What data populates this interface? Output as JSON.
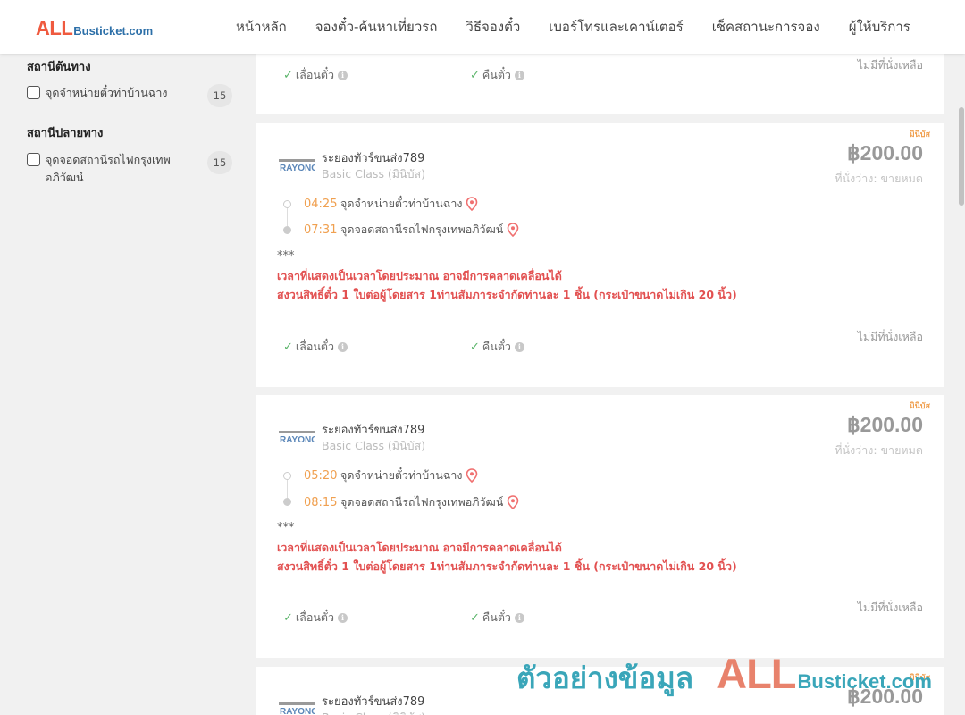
{
  "header": {
    "logo_all": "ALL",
    "logo_rest": "Busticket.com",
    "nav": [
      "หน้าหลัก",
      "จองตั๋ว-ค้นหาเที่ยวรถ",
      "วิธีจองตั๋ว",
      "เบอร์โทรและเคาน์เตอร์",
      "เช็คสถานะการจอง",
      "ผู้ให้บริการ"
    ]
  },
  "sidebar": {
    "origin_title": "สถานีต้นทาง",
    "origin_items": [
      {
        "label": "จุดจำหน่ายตั๋วท่าบ้านฉาง",
        "count": "15"
      }
    ],
    "dest_title": "สถานีปลายทาง",
    "dest_items": [
      {
        "label": "จุดจอดสถานีรถไฟกรุงเทพอภิวัฒน์",
        "count": "15"
      }
    ]
  },
  "top_card": {
    "reschedule": "เลื่อนตั๋ว",
    "refund": "คืนตั๋ว",
    "no_seats": "ไม่มีที่นั่งเหลือ"
  },
  "trips": [
    {
      "tag": "มินิบัส",
      "operator": "ระยองทัวร์ขนส่ง789",
      "bus_class": "Basic Class (มินิบัส)",
      "price": "฿200.00",
      "seats": "ที่นั่งว่าง: ขายหมด",
      "depart_time": "04:25",
      "depart_station": "จุดจำหน่ายตั๋วท่าบ้านฉาง",
      "arrive_time": "07:31",
      "arrive_station": "จุดจอดสถานีรถไฟกรุงเทพอภิวัฒน์",
      "stars": "***",
      "warn1": "เวลาที่แสดงเป็นเวลาโดยประมาณ อาจมีการคลาดเคลื่อนได้",
      "warn2": "สงวนสิทธิ์ตั๋ว 1 ใบต่อผู้โดยสาร 1ท่านสัมภาระจำกัดท่านละ 1 ชิ้น (กระเป๋าขนาดไม่เกิน 20 นิ้ว)",
      "reschedule": "เลื่อนตั๋ว",
      "refund": "คืนตั๋ว",
      "no_seats": "ไม่มีที่นั่งเหลือ"
    },
    {
      "tag": "มินิบัส",
      "operator": "ระยองทัวร์ขนส่ง789",
      "bus_class": "Basic Class (มินิบัส)",
      "price": "฿200.00",
      "seats": "ที่นั่งว่าง: ขายหมด",
      "depart_time": "05:20",
      "depart_station": "จุดจำหน่ายตั๋วท่าบ้านฉาง",
      "arrive_time": "08:15",
      "arrive_station": "จุดจอดสถานีรถไฟกรุงเทพอภิวัฒน์",
      "stars": "***",
      "warn1": "เวลาที่แสดงเป็นเวลาโดยประมาณ อาจมีการคลาดเคลื่อนได้",
      "warn2": "สงวนสิทธิ์ตั๋ว 1 ใบต่อผู้โดยสาร 1ท่านสัมภาระจำกัดท่านละ 1 ชิ้น (กระเป๋าขนาดไม่เกิน 20 นิ้ว)",
      "reschedule": "เลื่อนตั๋ว",
      "refund": "คืนตั๋ว",
      "no_seats": "ไม่มีที่นั่งเหลือ"
    },
    {
      "tag": "มินิบัส",
      "operator": "ระยองทัวร์ขนส่ง789",
      "bus_class": "Basic Class (มินิบัส)",
      "price": "฿200.00"
    }
  ],
  "watermark": {
    "text": "ตัวอย่างข้อมูล",
    "all": "ALL",
    "rest": "Busticket.com"
  },
  "colors": {
    "accent_orange": "#f0a050",
    "warning_red": "#e25050",
    "logo_red": "#ef5a3f",
    "logo_blue": "#2c6fa8",
    "watermark_teal": "#3aa6b9"
  }
}
